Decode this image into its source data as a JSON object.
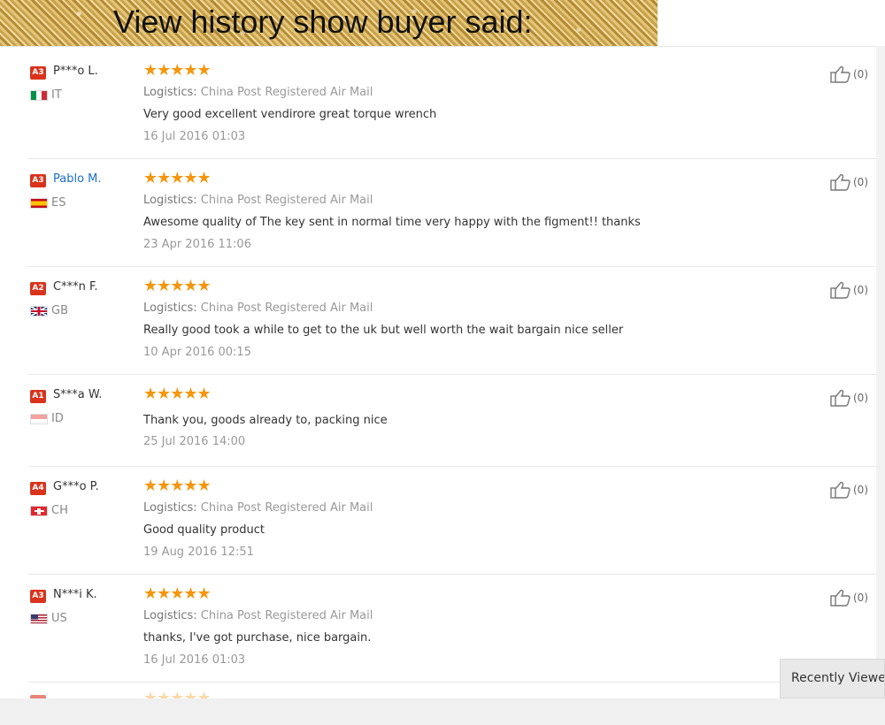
{
  "banner": {
    "title": "View history show buyer said:"
  },
  "reviews": [
    {
      "level": "A3",
      "name": "P***o L.",
      "country": "IT",
      "stars": "★★★★★",
      "logistics_label": "Logistics:",
      "logistics": "China Post Registered Air Mail",
      "text": "Very good excellent vendirore great torque wrench",
      "date": "16 Jul 2016 01:03",
      "likes": "(0)"
    },
    {
      "level": "A3",
      "name": "Pablo M.",
      "country": "ES",
      "stars": "★★★★★",
      "logistics_label": "Logistics:",
      "logistics": "China Post Registered Air Mail",
      "text": "Awesome quality of The key sent in normal time very happy with the figment!! thanks",
      "date": "23 Apr 2016 11:06",
      "likes": "(0)"
    },
    {
      "level": "A2",
      "name": "C***n F.",
      "country": "GB",
      "stars": "★★★★★",
      "logistics_label": "Logistics:",
      "logistics": "China Post Registered Air Mail",
      "text": "Really good took a while to get to the uk but well worth the wait bargain nice seller",
      "date": "10 Apr 2016 00:15",
      "likes": "(0)"
    },
    {
      "level": "A1",
      "name": "S***a W.",
      "country": "ID",
      "stars": "★★★★★",
      "text": "Thank you, goods already to, packing nice",
      "date": "25 Jul 2016 14:00",
      "likes": "(0)"
    },
    {
      "level": "A4",
      "name": "G***o P.",
      "country": "CH",
      "stars": "★★★★★",
      "logistics_label": "Logistics:",
      "logistics": "China Post Registered Air Mail",
      "text": "Good quality product",
      "date": "19 Aug 2016 12:51",
      "likes": "(0)"
    },
    {
      "level": "A3",
      "name": "N***i K.",
      "country": "US",
      "stars": "★★★★★",
      "logistics_label": "Logistics:",
      "logistics": "China Post Registered Air Mail",
      "text": "thanks, I've got purchase, nice bargain.",
      "date": "16 Jul 2016 01:03",
      "likes": "(0)"
    }
  ],
  "partial_review": {
    "stars": "★★★★★"
  },
  "recently_viewed": {
    "label": "Recently Viewed"
  },
  "colors": {
    "badge": "#d9331c",
    "star": "#f5960d",
    "link": "#1a6fc7"
  }
}
